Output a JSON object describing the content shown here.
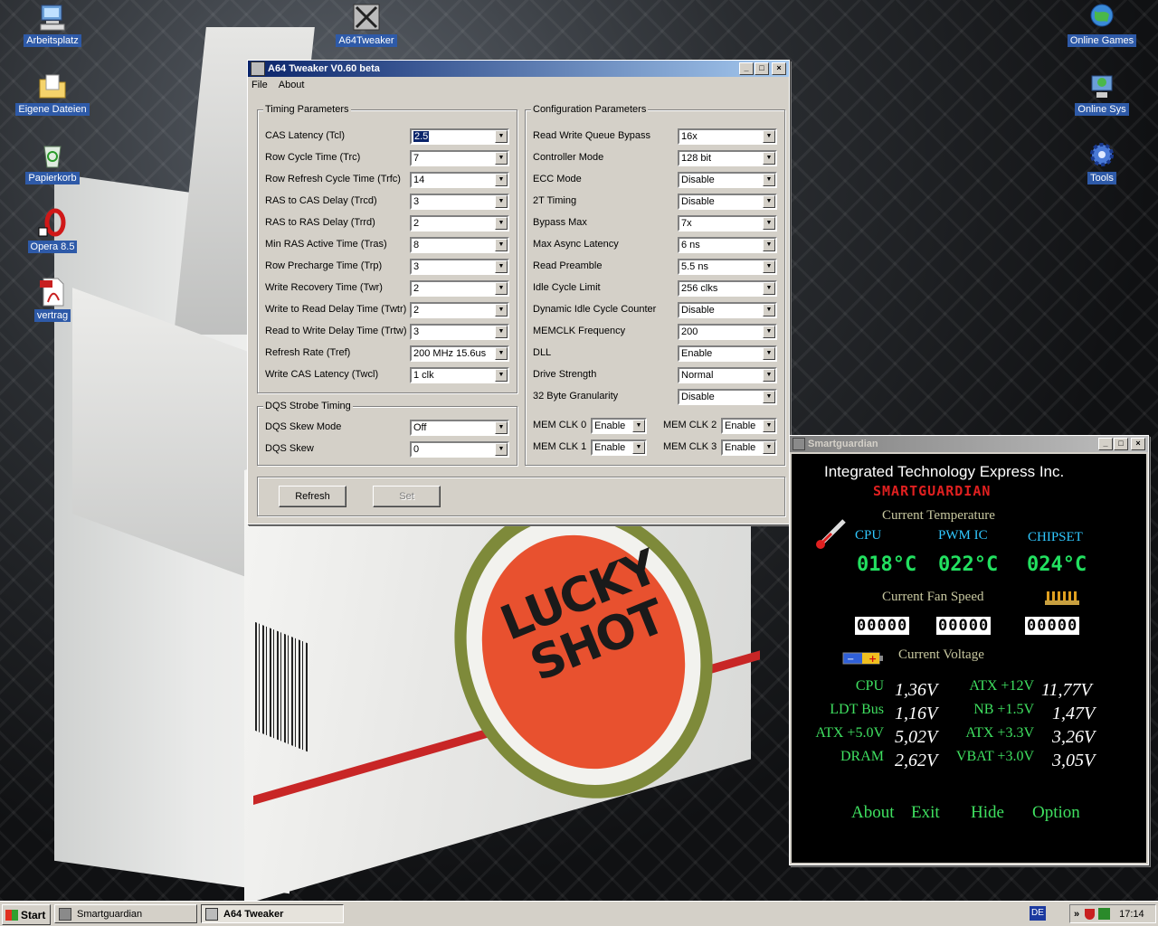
{
  "desktop": {
    "icons": [
      {
        "label": "Arbeitsplatz"
      },
      {
        "label": "Eigene Dateien"
      },
      {
        "label": "Papierkorb"
      },
      {
        "label": "Opera 8.5"
      },
      {
        "label": "vertrag"
      },
      {
        "label": "A64Tweaker"
      },
      {
        "label": "Online Games"
      },
      {
        "label": "Online Sys"
      },
      {
        "label": "Tools"
      }
    ],
    "wallpaper_text": "LUCKY SHOT"
  },
  "tweaker": {
    "title": "A64 Tweaker V0.60 beta",
    "menu": [
      "File",
      "About"
    ],
    "timing_title": "Timing Parameters",
    "timing": [
      {
        "label": "CAS Latency (Tcl)",
        "value": "2.5"
      },
      {
        "label": "Row Cycle Time (Trc)",
        "value": "7"
      },
      {
        "label": "Row Refresh Cycle Time (Trfc)",
        "value": "14"
      },
      {
        "label": "RAS to CAS Delay (Trcd)",
        "value": "3"
      },
      {
        "label": "RAS to RAS Delay (Trrd)",
        "value": "2"
      },
      {
        "label": "Min RAS Active Time (Tras)",
        "value": "8"
      },
      {
        "label": "Row Precharge Time (Trp)",
        "value": "3"
      },
      {
        "label": "Write Recovery Time (Twr)",
        "value": "2"
      },
      {
        "label": "Write to Read Delay Time (Twtr)",
        "value": "2"
      },
      {
        "label": "Read to Write Delay Time (Trtw)",
        "value": "3"
      },
      {
        "label": "Refresh Rate (Tref)",
        "value": "200 MHz 15.6us"
      },
      {
        "label": "Write CAS Latency (Twcl)",
        "value": "1 clk"
      }
    ],
    "dqs_title": "DQS Strobe Timing",
    "dqs": [
      {
        "label": "DQS Skew Mode",
        "value": "Off"
      },
      {
        "label": "DQS Skew",
        "value": "0"
      }
    ],
    "config_title": "Configuration Parameters",
    "config": [
      {
        "label": "Read Write Queue Bypass",
        "value": "16x"
      },
      {
        "label": "Controller Mode",
        "value": "128 bit"
      },
      {
        "label": "ECC Mode",
        "value": "Disable"
      },
      {
        "label": "2T Timing",
        "value": "Disable"
      },
      {
        "label": "Bypass Max",
        "value": "7x"
      },
      {
        "label": "Max Async Latency",
        "value": "6 ns"
      },
      {
        "label": "Read Preamble",
        "value": "5.5 ns"
      },
      {
        "label": "Idle Cycle Limit",
        "value": "256 clks"
      },
      {
        "label": "Dynamic Idle Cycle Counter",
        "value": "Disable"
      },
      {
        "label": "MEMCLK Frequency",
        "value": "200"
      },
      {
        "label": "DLL",
        "value": "Enable"
      },
      {
        "label": "Drive Strength",
        "value": "Normal"
      },
      {
        "label": "32 Byte Granularity",
        "value": "Disable"
      }
    ],
    "memclk": [
      {
        "label": "MEM CLK 0",
        "value": "Enable"
      },
      {
        "label": "MEM CLK 2",
        "value": "Enable"
      },
      {
        "label": "MEM CLK 1",
        "value": "Enable"
      },
      {
        "label": "MEM CLK 3",
        "value": "Enable"
      }
    ],
    "refresh_label": "Refresh",
    "set_label": "Set"
  },
  "smartguardian": {
    "title": "Smartguardian",
    "company": "Integrated Technology Express Inc.",
    "brand": "SMARTGUARDIAN",
    "temp_title": "Current Temperature",
    "temps": [
      {
        "label": "CPU",
        "value": "018°C"
      },
      {
        "label": "PWM IC",
        "value": "022°C"
      },
      {
        "label": "CHIPSET",
        "value": "024°C"
      }
    ],
    "fan_title": "Current Fan Speed",
    "fans": [
      "00000",
      "00000",
      "00000"
    ],
    "volt_title": "Current Voltage",
    "volts_left": [
      {
        "label": "CPU",
        "value": "1,36V"
      },
      {
        "label": "LDT Bus",
        "value": "1,16V"
      },
      {
        "label": "ATX +5.0V",
        "value": "5,02V"
      },
      {
        "label": "DRAM",
        "value": "2,62V"
      }
    ],
    "volts_right": [
      {
        "label": "ATX +12V",
        "value": "11,77V"
      },
      {
        "label": "NB +1.5V",
        "value": "1,47V"
      },
      {
        "label": "ATX +3.3V",
        "value": "3,26V"
      },
      {
        "label": "VBAT +3.0V",
        "value": "3,05V"
      }
    ],
    "buttons": [
      "About",
      "Exit",
      "Hide",
      "Option"
    ]
  },
  "taskbar": {
    "start": "Start",
    "tasks": [
      "Smartguardian",
      "A64 Tweaker"
    ],
    "lang": "DE",
    "clock": "17:14"
  },
  "colors": {
    "accent": "#0a246a",
    "lcd_green": "#22e060",
    "brand_red": "#e02020",
    "title_cyan": "#30c8ff"
  }
}
